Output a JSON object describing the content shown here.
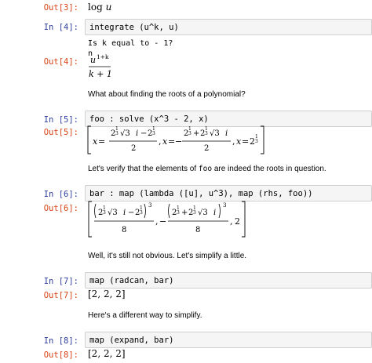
{
  "cells": [
    {
      "out_prompt": "Out[3]:",
      "output_math": "log u"
    },
    {
      "in_prompt": "In [4]:",
      "code": "integrate (u^k, u)",
      "stdout": "Is k equal to - 1?\nn",
      "out_prompt": "Out[4]:"
    },
    {
      "markdown": "What about finding the roots of a polynomial?"
    },
    {
      "in_prompt": "In [5]:",
      "code": "foo : solve (x^3 - 2, x)",
      "out_prompt": "Out[5]:"
    },
    {
      "markdown_parts": [
        "Let's verify that the elements of ",
        "foo",
        " are indeed the roots in question."
      ]
    },
    {
      "in_prompt": "In [6]:",
      "code": "bar : map (lambda ([u], u^3), map (rhs, foo))",
      "out_prompt": "Out[6]:"
    },
    {
      "markdown": "Well, it's still not obvious. Let's simplify a little."
    },
    {
      "in_prompt": "In [7]:",
      "code": "map (radcan, bar)",
      "out_prompt": "Out[7]:",
      "output_math": "[2, 2, 2]"
    },
    {
      "markdown": "Here's a different way to simplify."
    },
    {
      "in_prompt": "In [8]:",
      "code": "map (expand, bar)",
      "out_prompt": "Out[8]:",
      "output_math": "[2, 2, 2]"
    }
  ],
  "math": {
    "log_fn": "log",
    "log_arg": "u",
    "int_numer_base": "u",
    "int_numer_exp": "1+k",
    "int_denom": "k + 1",
    "roots": {
      "x": "x",
      "eq": "=",
      "two": "2",
      "third": "1",
      "third_den": "3",
      "sqrt3": "√3",
      "i": "i",
      "minus": "−",
      "plus": "+",
      "comma": ","
    },
    "cube_exp": "3",
    "eight": "8",
    "last_two": "2"
  }
}
